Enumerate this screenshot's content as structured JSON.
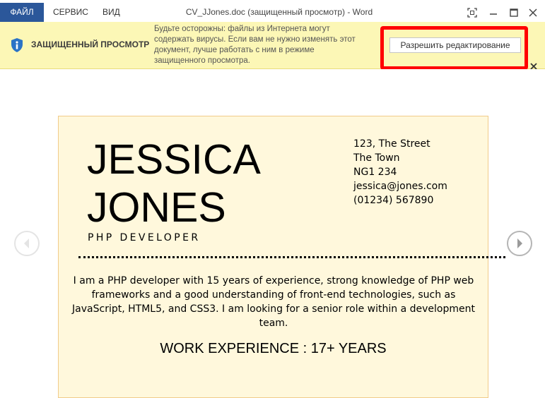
{
  "app": {
    "window_title": "CV_JJones.doc (защищенный просмотр) - Word",
    "accent_color": "#2b579a"
  },
  "ribbon": {
    "tabs": [
      {
        "label": "ФАЙЛ",
        "active": true
      },
      {
        "label": "СЕРВИС",
        "active": false
      },
      {
        "label": "ВИД",
        "active": false
      }
    ]
  },
  "window_controls": {
    "icons": [
      "fullscreen-icon",
      "minimize-icon",
      "maximize-icon",
      "close-icon"
    ]
  },
  "protected_view": {
    "title": "ЗАЩИЩЕННЫЙ ПРОСМОТР",
    "message": "Будьте осторожны: файлы из Интернета могут содержать вирусы. Если вам не нужно изменять этот документ, лучше работать с ним в режиме защищенного просмотра.",
    "enable_button_label": "Разрешить редактирование",
    "highlight_color": "#ff0000",
    "bar_color": "#fcf7b6"
  },
  "document": {
    "name_first": "JESSICA",
    "name_last": "JONES",
    "job_title": "PHP DEVELOPER",
    "address_lines": [
      "123, The Street",
      "The Town",
      "NG1 234",
      "jessica@jones.com",
      "(01234) 567890"
    ],
    "summary": "I am a PHP developer with 15 years of experience, strong knowledge of PHP web frameworks and a good understanding of front-end technologies, such as JavaScript, HTML5, and CSS3. I am looking for a senior role within a development team.",
    "section_heading": "WORK EXPERIENCE : 17+ YEARS",
    "page_color": "#fff8dc"
  },
  "navigation": {
    "prev_icon": "chevron-left-circle-icon",
    "next_icon": "chevron-right-circle-icon"
  }
}
